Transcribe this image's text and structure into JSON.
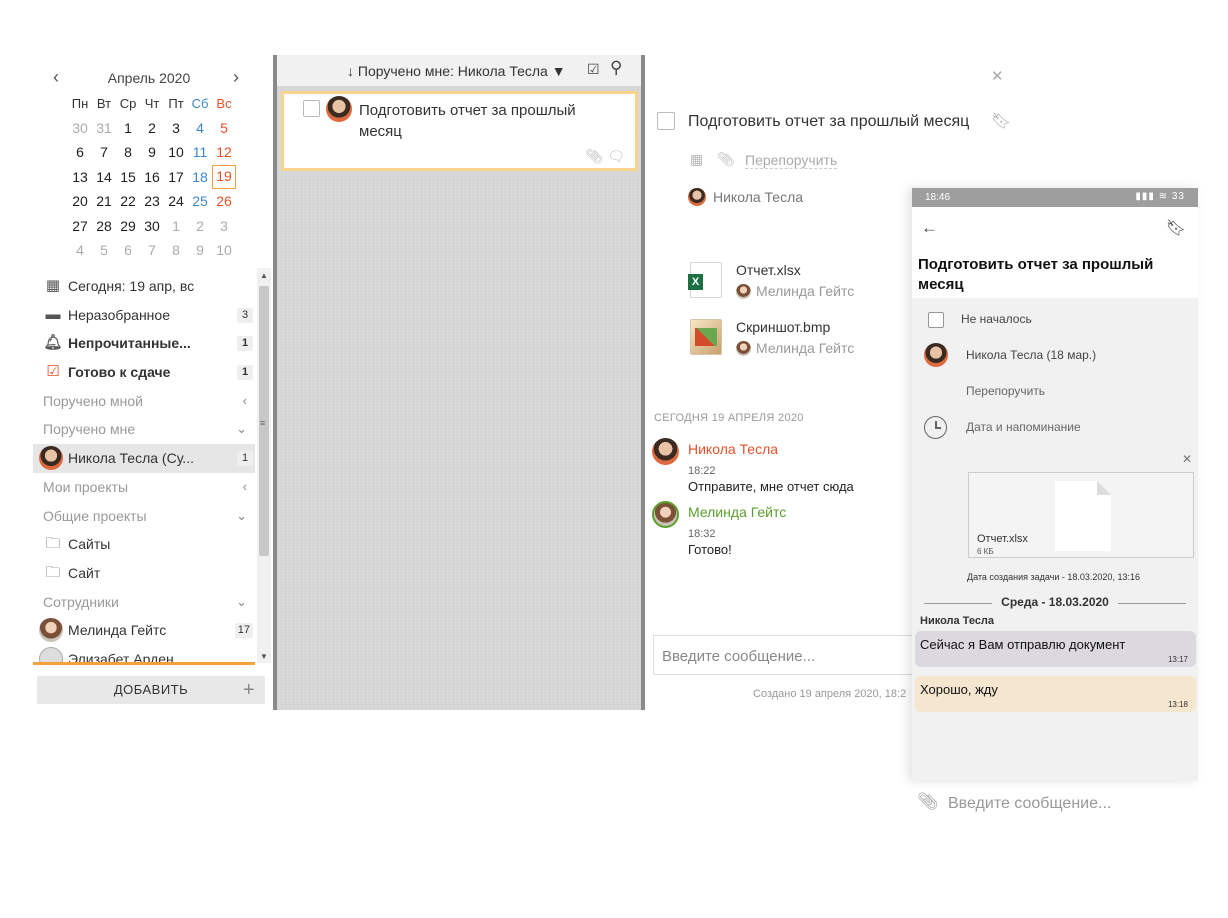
{
  "calendar": {
    "month": "Апрель 2020",
    "weekdays": [
      "Пн",
      "Вт",
      "Ср",
      "Чт",
      "Пт",
      "Сб",
      "Вс"
    ],
    "weeks": [
      [
        "30",
        "31",
        "1",
        "2",
        "3",
        "4",
        "5"
      ],
      [
        "6",
        "7",
        "8",
        "9",
        "10",
        "11",
        "12"
      ],
      [
        "13",
        "14",
        "15",
        "16",
        "17",
        "18",
        "19"
      ],
      [
        "20",
        "21",
        "22",
        "23",
        "24",
        "25",
        "26"
      ],
      [
        "27",
        "28",
        "29",
        "30",
        "1",
        "2",
        "3"
      ],
      [
        "4",
        "5",
        "6",
        "7",
        "8",
        "9",
        "10"
      ]
    ],
    "today": "19"
  },
  "nav": {
    "today": "Сегодня: 19 апр, вс",
    "unsorted": {
      "label": "Неразобранное",
      "count": "3"
    },
    "unread": {
      "label": "Непрочитанные...",
      "count": "1"
    },
    "ready": {
      "label": "Готово к сдаче",
      "count": "1"
    },
    "assigned_by_me": "Поручено мной",
    "assigned_to_me": "Поручено мне",
    "tesla_item": {
      "label": "Никола Тесла (Су...",
      "count": "1"
    },
    "my_projects": "Мои проекты",
    "shared_projects": "Общие проекты",
    "project_1": "Сайты",
    "project_2": "Сайт",
    "employees": "Сотрудники",
    "melinda": {
      "label": "Мелинда Гейтс",
      "count": "17"
    },
    "elizabeth": "Элизабет Арден",
    "add_button": "ДОБАВИТЬ"
  },
  "middle": {
    "filter": "↓ Поручено мне: Никола Тесла",
    "task_title": "Подготовить отчет за прошлый месяц"
  },
  "detail": {
    "title": "Подготовить отчет за прошлый месяц",
    "reassign": "Перепоручить",
    "assignee": "Никола Тесла",
    "files": [
      {
        "name": "Отчет.xlsx",
        "author": "Мелинда Гейтс"
      },
      {
        "name": "Скриншот.bmp",
        "author": "Мелинда Гейтс"
      }
    ],
    "date_separator": "СЕГОДНЯ 19 АПРЕЛЯ 2020",
    "messages": [
      {
        "author": "Никола Тесла",
        "time": "18:22",
        "text": "Отправите, мне отчет сюда",
        "color": "#e5512b"
      },
      {
        "author": "Мелинда Гейтс",
        "time": "18:32",
        "text": "Готово!",
        "color": "#5aa02c"
      }
    ],
    "input_placeholder": "Введите сообщение...",
    "created": "Создано 19 апреля 2020, 18:2"
  },
  "phone": {
    "status_time": "18:46",
    "status_icons": "▮▮▮ ≋ 33",
    "title": "Подготовить отчет за прошлый месяц",
    "status": "Не началось",
    "assignee": "Никола Тесла (18 мар.)",
    "reassign": "Перепоручить",
    "date_reminder": "Дата и напоминание",
    "file_name": "Отчет.xlsx",
    "file_size": "6 КБ",
    "created": "Дата создания задачи - 18.03.2020, 13:16",
    "date_separator": "Среда - 18.03.2020",
    "sender": "Никола Тесла",
    "messages": [
      {
        "text": "Сейчас я Вам отправлю документ",
        "time": "13:17"
      },
      {
        "text": "Хорошо, жду",
        "time": "13:18"
      }
    ],
    "input_placeholder": "Введите сообщение..."
  }
}
